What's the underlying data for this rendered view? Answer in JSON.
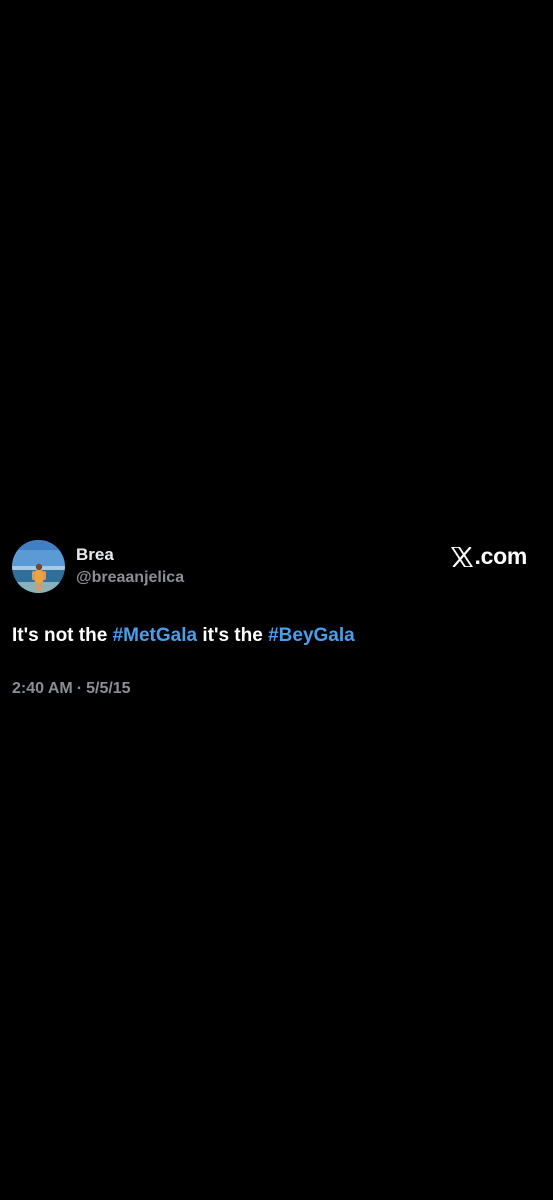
{
  "colors": {
    "background": "#000000",
    "text": "#ffffff",
    "secondary_text": "#8b8f93",
    "hashtag": "#4c9ee8"
  },
  "tweet": {
    "author": {
      "display_name": "Brea",
      "handle": "@breaanjelica",
      "avatar_icon": "profile-photo"
    },
    "brand": {
      "logo_icon": "x-logo-icon",
      "text": ".com"
    },
    "body": {
      "text_1": "It's not the ",
      "hashtag_1": "#MetGala",
      "text_2": " it's the ",
      "hashtag_2": "#BeyGala"
    },
    "timestamp": {
      "time": "2:40 AM",
      "separator": "·",
      "date": "5/5/15"
    }
  }
}
